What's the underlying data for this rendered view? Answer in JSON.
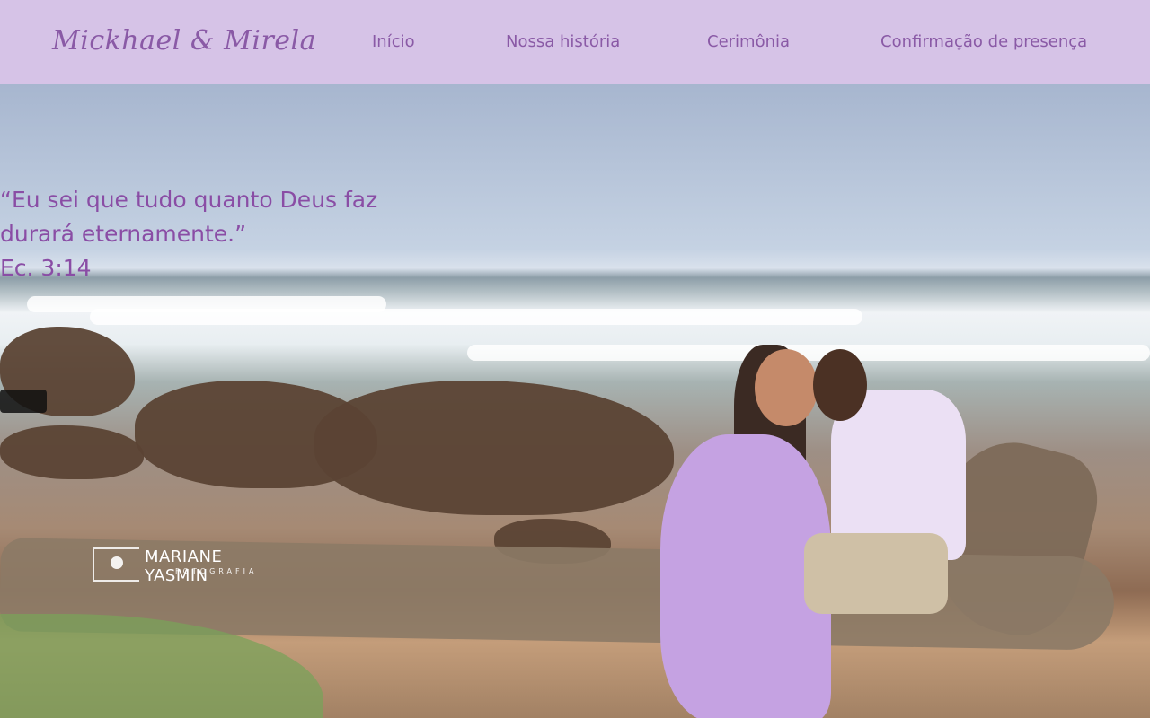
{
  "header": {
    "logo": "Mickhael & Mirela",
    "menu": [
      "Início",
      "Nossa história",
      "Cerimônia",
      "Confirmação de presença"
    ]
  },
  "hero": {
    "quote_line1": "“Eu sei que tudo quanto Deus faz",
    "quote_line2": "durará eternamente.”",
    "reference": "Ec. 3:14",
    "watermark_title": "MARIANE YASMIN",
    "watermark_sub": "FOTOGRAFIA"
  },
  "colors": {
    "nav_bg": "#d6c3e7",
    "accent": "#8a5aa6",
    "quote": "#8a4da5"
  }
}
